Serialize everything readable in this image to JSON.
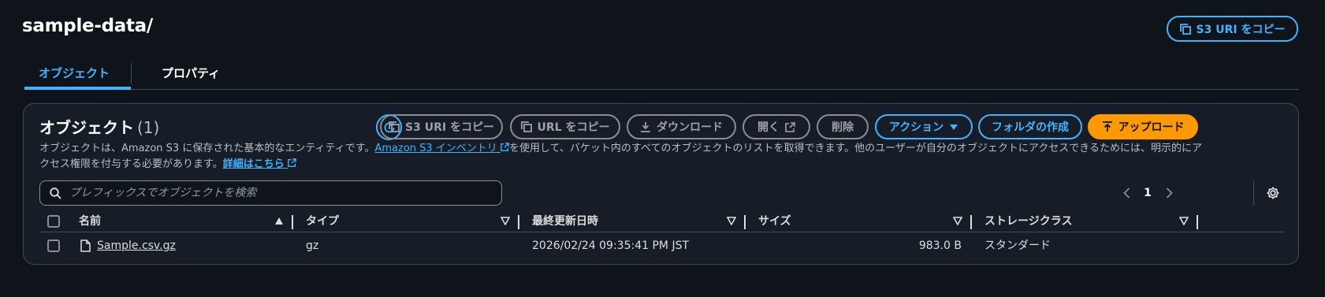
{
  "page": {
    "title": "sample-data/",
    "copy_uri_label": "S3 URI をコピー"
  },
  "tabs": [
    {
      "label": "オブジェクト",
      "active": true
    },
    {
      "label": "プロパティ",
      "active": false
    }
  ],
  "panel": {
    "title": "オブジェクト",
    "count": "(1)",
    "toolbar": {
      "copy_s3_uri": "S3 URI をコピー",
      "copy_url": "URL をコピー",
      "download": "ダウンロード",
      "open": "開く",
      "delete": "削除",
      "actions": "アクション",
      "create_folder": "フォルダの作成",
      "upload": "アップロード"
    },
    "description": {
      "part1": "オブジェクトは、Amazon S3 に保存された基本的なエンティティです。",
      "inventory_link": "Amazon S3 インベントリ",
      "part2": "を使用して、バケット内のすべてのオブジェクトのリストを取得できます。他のユーザーが自分のオブジェクトにアクセスできるためには、明示的にア",
      "part3": "クセス権限を付与する必要があります。",
      "details_link": "詳細はこちら"
    },
    "search": {
      "placeholder": "プレフィックスでオブジェクトを検索",
      "value": ""
    },
    "pagination": {
      "current_page": "1"
    }
  },
  "table": {
    "columns": [
      "名前",
      "タイプ",
      "最終更新日時",
      "サイズ",
      "ストレージクラス"
    ],
    "rows": [
      {
        "name": "Sample.csv.gz",
        "type": "gz",
        "last_modified": "2026/02/24 09:35:41 PM JST",
        "size": "983.0 B",
        "storage_class": "スタンダード"
      }
    ]
  },
  "colors": {
    "background": "#0f141a",
    "panel": "#161d26",
    "link": "#42b4ff",
    "accent": "#ff9900",
    "border": "#414d5c"
  },
  "icons": [
    "copy-icon",
    "refresh-icon",
    "download-icon",
    "external-link-icon",
    "caret-down-icon",
    "upload-icon",
    "search-icon",
    "chevron-left-icon",
    "chevron-right-icon",
    "settings-icon",
    "file-icon",
    "sort-ascending-icon",
    "sort-descending-icon"
  ]
}
